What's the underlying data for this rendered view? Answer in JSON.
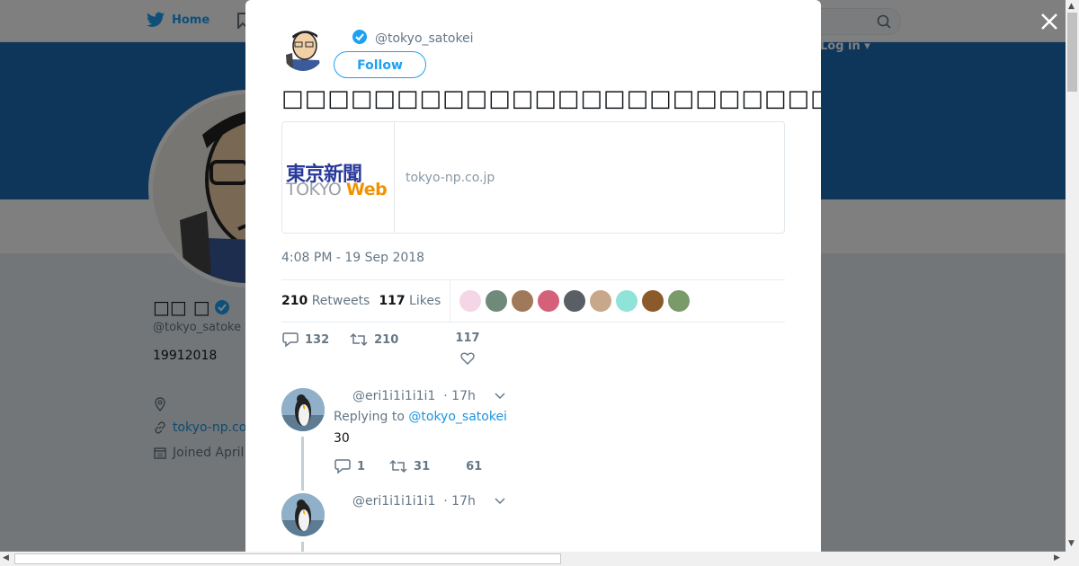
{
  "background": {
    "nav": {
      "home_label": "Home",
      "login_label": "Log in ▾"
    },
    "profile": {
      "name": "□□ □",
      "handle": "@tokyo_satoke",
      "bio": "19912018",
      "url": "tokyo-np.co",
      "joined": "Joined April"
    }
  },
  "tweet": {
    "author_handle": "@tokyo_satokei",
    "follow_label": "Follow",
    "text": "□□□□□□□□□□□□□□□□□□□□□□□□□□□□□□□□□□□□□□□□",
    "card": {
      "domain": "tokyo-np.co.jp",
      "logo_top": "東京新聞",
      "logo_tokyo": "TOKYO",
      "logo_web": "Web"
    },
    "timestamp": "4:08 PM - 19 Sep 2018",
    "retweets_count": "210",
    "retweets_label": "Retweets",
    "likes_count": "117",
    "likes_label": "Likes",
    "liker_colors": [
      "#f4d6e6",
      "#6f8a7a",
      "#a0785a",
      "#d4607a",
      "#5a5f66",
      "#c8a88a",
      "#8fe3d8",
      "#8a5a2a",
      "#7a9a6a"
    ],
    "actions": {
      "replies": "132",
      "retweets": "210",
      "likes": "117"
    }
  },
  "replies": [
    {
      "handle": "@eri1i1i1i1i1",
      "time": "· 17h",
      "replying_prefix": "Replying to",
      "replying_to": "@tokyo_satokei",
      "text": "30",
      "actions": {
        "replies": "1",
        "retweets": "31",
        "likes": "61"
      }
    },
    {
      "handle": "@eri1i1i1i1i1",
      "time": "· 17h"
    }
  ]
}
